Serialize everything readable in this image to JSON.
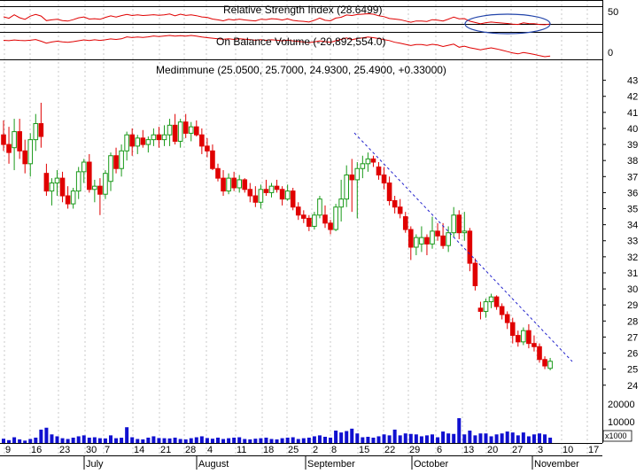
{
  "colors": {
    "up": "#1a9a1a",
    "down": "#e00000",
    "volume": "#1010d0",
    "indicator": "#e00000",
    "trendline": "#2222cc",
    "ellipse": "#2244aa",
    "grid": "#c8c8c8"
  },
  "rsi_panel": {
    "title": "Relative Strength Index (28.6499)",
    "ticks": [
      "50"
    ],
    "levels": [
      70,
      30
    ]
  },
  "obv_panel": {
    "title": "On Balance Volume (-20,892,554.0)",
    "ticks": [
      "0"
    ]
  },
  "price_panel": {
    "title": "Medimmune (25.0500, 25.7000, 24.9300, 25.4900, +0.33000)"
  },
  "volume_panel": {
    "ticks": [
      "20000",
      "10000"
    ],
    "unit": "x1000"
  },
  "chart_data": {
    "type": "candlestick",
    "title": "Medimmune (25.0500, 25.7000, 24.9300, 25.4900, +0.33000)",
    "y_ticks": [
      "43",
      "42",
      "41",
      "40",
      "39",
      "38",
      "37",
      "36",
      "35",
      "34",
      "33",
      "32",
      "31",
      "30",
      "29",
      "28",
      "27",
      "26",
      "25",
      "24"
    ],
    "ylim": [
      23.6,
      43.2
    ],
    "x_day_labels": [
      "9",
      "16",
      "23",
      "30",
      "7",
      "14",
      "21",
      "28",
      "4",
      "11",
      "18",
      "25",
      "2",
      "8",
      "15",
      "22",
      "29",
      "6",
      "13",
      "20",
      "27",
      "3",
      "10",
      "17"
    ],
    "x_month_labels": [
      "July",
      "August",
      "September",
      "October",
      "November"
    ],
    "ohlc": [
      [
        39.6,
        40.5,
        38.6,
        39.0
      ],
      [
        39.0,
        40.1,
        37.8,
        38.5
      ],
      [
        38.8,
        40.6,
        37.4,
        39.8
      ],
      [
        39.8,
        40.6,
        38.1,
        38.6
      ],
      [
        38.6,
        39.3,
        37.2,
        37.8
      ],
      [
        37.8,
        39.7,
        37.0,
        39.3
      ],
      [
        39.3,
        40.9,
        38.6,
        40.3
      ],
      [
        40.3,
        41.6,
        38.8,
        39.5
      ],
      [
        37.2,
        37.8,
        35.8,
        36.1
      ],
      [
        36.1,
        36.9,
        35.2,
        36.6
      ],
      [
        36.6,
        37.4,
        35.8,
        36.9
      ],
      [
        36.9,
        37.3,
        35.4,
        35.8
      ],
      [
        35.8,
        36.4,
        35.0,
        35.3
      ],
      [
        35.3,
        36.3,
        35.0,
        36.1
      ],
      [
        36.1,
        37.6,
        35.6,
        37.3
      ],
      [
        37.3,
        38.1,
        36.6,
        37.9
      ],
      [
        37.9,
        38.4,
        36.0,
        36.2
      ],
      [
        36.2,
        36.8,
        35.4,
        36.4
      ],
      [
        36.4,
        36.9,
        34.6,
        35.9
      ],
      [
        35.9,
        37.4,
        35.6,
        37.2
      ],
      [
        36.7,
        38.5,
        36.1,
        38.3
      ],
      [
        38.3,
        38.8,
        37.2,
        37.5
      ],
      [
        37.5,
        39.0,
        37.0,
        38.6
      ],
      [
        38.6,
        39.8,
        38.0,
        39.6
      ],
      [
        39.6,
        40.0,
        38.3,
        38.9
      ],
      [
        38.9,
        39.6,
        38.4,
        39.4
      ],
      [
        39.4,
        39.9,
        38.8,
        39.0
      ],
      [
        39.0,
        39.5,
        38.5,
        39.3
      ],
      [
        39.3,
        40.0,
        38.9,
        39.6
      ],
      [
        39.6,
        40.1,
        38.8,
        39.3
      ],
      [
        39.3,
        40.2,
        38.9,
        39.6
      ],
      [
        39.6,
        40.6,
        38.9,
        40.2
      ],
      [
        40.2,
        40.9,
        39.0,
        39.2
      ],
      [
        39.2,
        40.6,
        38.8,
        40.4
      ],
      [
        40.4,
        40.9,
        39.4,
        39.7
      ],
      [
        39.7,
        40.4,
        39.2,
        40.1
      ],
      [
        40.1,
        40.5,
        39.5,
        39.6
      ],
      [
        39.6,
        40.0,
        38.4,
        38.9
      ],
      [
        38.9,
        39.4,
        38.2,
        38.6
      ],
      [
        38.6,
        39.0,
        37.4,
        37.5
      ],
      [
        37.5,
        37.8,
        36.7,
        36.9
      ],
      [
        36.9,
        37.4,
        35.8,
        36.1
      ],
      [
        36.1,
        37.2,
        35.9,
        36.9
      ],
      [
        36.9,
        37.3,
        36.1,
        36.3
      ],
      [
        36.3,
        37.1,
        36.0,
        36.8
      ],
      [
        36.8,
        36.9,
        36.0,
        36.2
      ],
      [
        36.2,
        36.6,
        35.4,
        35.8
      ],
      [
        35.8,
        36.4,
        35.1,
        35.4
      ],
      [
        35.4,
        36.5,
        35.0,
        36.2
      ],
      [
        36.2,
        36.8,
        35.8,
        36.0
      ],
      [
        36.0,
        36.6,
        35.7,
        36.4
      ],
      [
        36.4,
        36.8,
        36.0,
        36.2
      ],
      [
        36.2,
        36.4,
        35.2,
        35.6
      ],
      [
        35.6,
        36.5,
        35.5,
        36.1
      ],
      [
        36.1,
        36.3,
        34.9,
        35.1
      ],
      [
        35.1,
        35.4,
        34.3,
        34.6
      ],
      [
        34.6,
        34.9,
        34.1,
        34.4
      ],
      [
        34.4,
        34.6,
        33.6,
        33.9
      ],
      [
        33.9,
        34.8,
        33.7,
        34.6
      ],
      [
        34.6,
        35.8,
        34.4,
        35.6
      ],
      [
        34.6,
        35.2,
        33.8,
        34.1
      ],
      [
        34.1,
        34.3,
        33.4,
        33.7
      ],
      [
        33.7,
        35.3,
        33.6,
        35.1
      ],
      [
        35.1,
        36.8,
        34.2,
        35.6
      ],
      [
        35.6,
        37.7,
        35.1,
        37.1
      ],
      [
        37.1,
        38.1,
        34.8,
        36.8
      ],
      [
        36.8,
        37.9,
        34.4,
        37.5
      ],
      [
        37.5,
        38.3,
        36.9,
        37.8
      ],
      [
        37.8,
        38.5,
        37.3,
        38.1
      ],
      [
        38.1,
        38.3,
        37.6,
        37.9
      ],
      [
        37.6,
        37.9,
        36.8,
        37.1
      ],
      [
        37.1,
        37.6,
        36.2,
        36.6
      ],
      [
        36.6,
        37.0,
        35.2,
        35.5
      ],
      [
        35.5,
        35.8,
        34.7,
        35.1
      ],
      [
        35.1,
        35.6,
        34.4,
        34.7
      ],
      [
        34.5,
        34.8,
        33.5,
        33.7
      ],
      [
        33.7,
        33.9,
        31.8,
        32.6
      ],
      [
        32.6,
        33.4,
        32.1,
        33.2
      ],
      [
        32.8,
        33.9,
        32.3,
        33.2
      ],
      [
        33.2,
        33.4,
        32.1,
        32.8
      ],
      [
        32.8,
        34.5,
        32.5,
        33.6
      ],
      [
        33.6,
        34.1,
        33.0,
        33.3
      ],
      [
        33.3,
        34.1,
        32.5,
        32.7
      ],
      [
        32.7,
        33.9,
        32.3,
        33.5
      ],
      [
        33.5,
        35.1,
        33.2,
        34.6
      ],
      [
        34.6,
        34.9,
        33.1,
        33.5
      ],
      [
        33.5,
        34.8,
        33.0,
        33.6
      ],
      [
        33.6,
        33.8,
        31.1,
        31.6
      ],
      [
        31.6,
        31.9,
        29.9,
        30.2
      ],
      [
        28.8,
        29.2,
        28.1,
        28.6
      ],
      [
        28.6,
        29.4,
        28.2,
        29.2
      ],
      [
        29.2,
        29.7,
        28.8,
        29.5
      ],
      [
        29.5,
        29.6,
        28.7,
        28.9
      ],
      [
        28.9,
        29.1,
        28.1,
        28.4
      ],
      [
        28.4,
        28.6,
        27.5,
        27.9
      ],
      [
        27.9,
        28.2,
        26.6,
        27.1
      ],
      [
        27.1,
        27.4,
        26.4,
        26.7
      ],
      [
        26.7,
        27.6,
        26.5,
        27.4
      ],
      [
        27.4,
        27.8,
        26.3,
        26.6
      ],
      [
        26.6,
        27.1,
        26.1,
        26.4
      ],
      [
        26.4,
        26.6,
        25.4,
        25.6
      ],
      [
        25.6,
        25.8,
        25.0,
        25.2
      ],
      [
        25.05,
        25.7,
        24.93,
        25.49
      ]
    ],
    "volume": [
      450,
      300,
      600,
      380,
      250,
      420,
      560,
      1400,
      1600,
      900,
      700,
      500,
      420,
      560,
      700,
      800,
      560,
      600,
      500,
      480,
      800,
      500,
      550,
      1650,
      600,
      420,
      380,
      560,
      700,
      520,
      500,
      480,
      560,
      420,
      380,
      500,
      600,
      700,
      520,
      450,
      560,
      420,
      500,
      560,
      600,
      420,
      380,
      450,
      500,
      560,
      420,
      380,
      500,
      560,
      600,
      420,
      500,
      560,
      700,
      800,
      650,
      560,
      1300,
      1100,
      1250,
      1500,
      1000,
      600,
      650,
      560,
      700,
      900,
      800,
      1400,
      800,
      1000,
      950,
      900,
      700,
      800,
      900,
      600,
      1200,
      1000,
      950,
      2600,
      900,
      1300,
      800,
      1000,
      1000,
      700,
      900,
      1000,
      1200,
      1100,
      800,
      1100,
      700,
      900,
      1000,
      900,
      560
    ]
  }
}
